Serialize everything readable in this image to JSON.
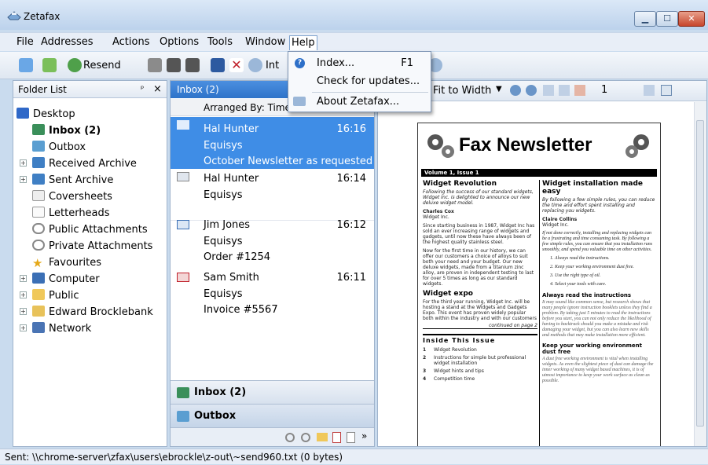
{
  "window": {
    "title": "Zetafax",
    "controls": {
      "minimize": "▁",
      "maximize": "☐",
      "close": "✕"
    }
  },
  "menubar": {
    "items": [
      "File",
      "Addresses",
      "Actions",
      "Options",
      "Tools",
      "Window",
      "Help"
    ]
  },
  "toolbar": {
    "resend_label": "Resend",
    "int_label": "Int"
  },
  "help_menu": {
    "items": [
      {
        "label": "Index...",
        "shortcut": "F1"
      },
      {
        "label": "Check for updates..."
      },
      {
        "label": "About Zetafax..."
      }
    ]
  },
  "folder_list": {
    "header": "Folder List",
    "pin": "ᵖ",
    "close": "×",
    "items": [
      {
        "label": "Desktop"
      },
      {
        "label": "Inbox (2)"
      },
      {
        "label": "Outbox"
      },
      {
        "label": "Received Archive"
      },
      {
        "label": "Sent Archive"
      },
      {
        "label": "Coversheets"
      },
      {
        "label": "Letterheads"
      },
      {
        "label": "Public Attachments"
      },
      {
        "label": "Private Attachments"
      },
      {
        "label": "Favourites"
      },
      {
        "label": "Computer"
      },
      {
        "label": "Public"
      },
      {
        "label": "Edward Brocklebank"
      },
      {
        "label": "Network"
      }
    ]
  },
  "inbox": {
    "header": "Inbox (2)",
    "arranged_by": "Arranged By: Time",
    "messages": [
      {
        "from": "Hal Hunter",
        "company": "Equisys",
        "subject": "October Newsletter as requested",
        "time": "16:16"
      },
      {
        "from": "Hal Hunter",
        "company": "Equisys",
        "subject": "",
        "time": "16:14"
      },
      {
        "from": "Jim Jones",
        "company": "Equisys",
        "subject": "Order #1254",
        "time": "16:12"
      },
      {
        "from": "Sam Smith",
        "company": "Equisys",
        "subject": "Invoice #5567",
        "time": "16:11"
      }
    ],
    "footer": {
      "inbox": "Inbox (2)",
      "outbox": "Outbox",
      "more": "»"
    }
  },
  "viewer": {
    "fit": "Fit to Width",
    "page_num": "1",
    "doc": {
      "title": "Fax Newsletter",
      "issue": "Volume 1, Issue 1",
      "col1_head": "Widget Revolution",
      "col1_intro": "Following the success of our standard widgets, Widget Inc. is delighted to announce our new deluxe widget model.",
      "author1": "Charles Cox",
      "author1_co": "Widget Inc.",
      "col1_body": "Since starting business in 1987, Widget Inc has sold an ever increasing range of widgets and gadgets, until now these have always been of the highest quality stainless steel.",
      "col1_body2": "Now for the first time in our history, we can offer our customers a choice of alloys to suit both your need and your budget. Our new deluxe widgets, made from a titanium zinc alloy, are proven in independent testing to last for over 5 times as long as our standard widgets.",
      "expo_head": "Widget expo",
      "expo_body": "For the third year running, Widget Inc. will be hosting a stand at the Widgets and Gadgets Expo. This event has proven widely popular both within the industry and with our customers",
      "continued": "continued on page 2",
      "inside_head": "Inside This Issue",
      "inside": [
        {
          "n": "1",
          "t": "Widget Revolution"
        },
        {
          "n": "2",
          "t": "Instructions for simple but professional widget installation"
        },
        {
          "n": "3",
          "t": "Widget hints and tips"
        },
        {
          "n": "4",
          "t": "Competition time"
        }
      ],
      "col2_head": "Widget installation made easy",
      "col2_intro": "By following a few simple rules, you can reduce the time and effort spent installing and replacing you widgets.",
      "author2": "Claire Collins",
      "author2_co": "Widget Inc.",
      "col2_body": "If not done correctly, installing and replacing widgets can be a frustrating and time consuming task. By following a few simple rules, you can ensure that you installation runs smoothly, and spend you valuable time on other activities.",
      "steps": [
        "Always read the instructions.",
        "Keep your working environment dust free.",
        "Use the right type of oil.",
        "Select your tools with care."
      ],
      "always_head": "Always read the instructions",
      "always_body": "It may sound like common sense, but research shows that many people ignore instruction booklets unless they find a problem. By taking just 5 minutes to read the instructions before you start, you can not only reduce the likelihood of having to backtrack should you make a mistake and risk damaging your widget, but you can also learn new skills and methods that may make installation more efficient.",
      "dust_head": "Keep your working environment dust free",
      "dust_body": "A dust free working environment is vital when installing widgets. As even the slightest piece of dust can damage the inner working of many widget based machines, it is of utmost importance to keep your work surface as clean as possible."
    }
  },
  "statusbar": {
    "text": "Sent: \\\\chrome-server\\zfax\\users\\ebrockle\\z-out\\~send960.txt (0 bytes)"
  }
}
